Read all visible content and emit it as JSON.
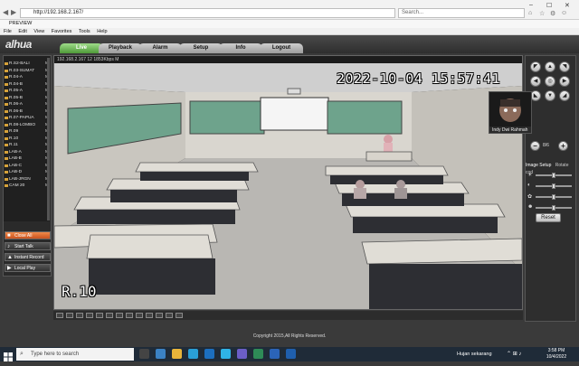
{
  "browser": {
    "url": "http://192.168.2.167/",
    "search_placeholder": "Search...",
    "tab_title": "PREVIEW",
    "menu": [
      "File",
      "Edit",
      "View",
      "Favorites",
      "Tools",
      "Help"
    ]
  },
  "app": {
    "logo": "alhua",
    "tabs": [
      "Live",
      "Playback",
      "Alarm",
      "Setup",
      "Info",
      "Logout"
    ],
    "active_tab": "Live"
  },
  "channels": [
    {
      "name": "R.S2-BALI",
      "mode": "M"
    },
    {
      "name": "R.03-SUMAT",
      "mode": "M"
    },
    {
      "name": "R.04-A",
      "mode": "M"
    },
    {
      "name": "R.04-B",
      "mode": "M"
    },
    {
      "name": "R.05-A",
      "mode": "M"
    },
    {
      "name": "R.05-B",
      "mode": "M"
    },
    {
      "name": "R.06-A",
      "mode": "M"
    },
    {
      "name": "R.06-B",
      "mode": "M"
    },
    {
      "name": "R.07-PAPUA",
      "mode": "M"
    },
    {
      "name": "R.08-LOMBO",
      "mode": "M"
    },
    {
      "name": "R.09",
      "mode": "M"
    },
    {
      "name": "R.10",
      "mode": "M"
    },
    {
      "name": "R.11",
      "mode": "M"
    },
    {
      "name": "LAB-A",
      "mode": "M"
    },
    {
      "name": "LAB-B",
      "mode": "M"
    },
    {
      "name": "LAB-C",
      "mode": "M"
    },
    {
      "name": "LAB-D",
      "mode": "M"
    },
    {
      "name": "LAB-JRGN",
      "mode": "M"
    },
    {
      "name": "CAM 20",
      "mode": "M"
    }
  ],
  "left_buttons": {
    "close_all": "Close All",
    "start_talk": "Start Talk",
    "instant_record": "Instant Record",
    "local_play": "Local Play"
  },
  "video": {
    "header": "192.168.2.167 12 1853Kbps M",
    "timestamp": "2022-10-04 15:57:41",
    "room": "R.10"
  },
  "ptz": {
    "zoom_label": "8/6",
    "pip_name": "Indy Dwi Rahmah"
  },
  "image_setup": {
    "tab1": "Image Setup",
    "tab2": "Rotate cod",
    "reset": "Reset"
  },
  "footer": {
    "copyright": "Copyright 2015,All Rights Reserved."
  },
  "taskbar": {
    "search_placeholder": "Type here to search",
    "weather": "Hujan sekarang",
    "time": "3:58 PM",
    "date": "10/4/2022"
  },
  "colors": {
    "active_tab": "#5aa844",
    "close_all": "#e0662c",
    "panel_bg": "#2e2e2e"
  }
}
